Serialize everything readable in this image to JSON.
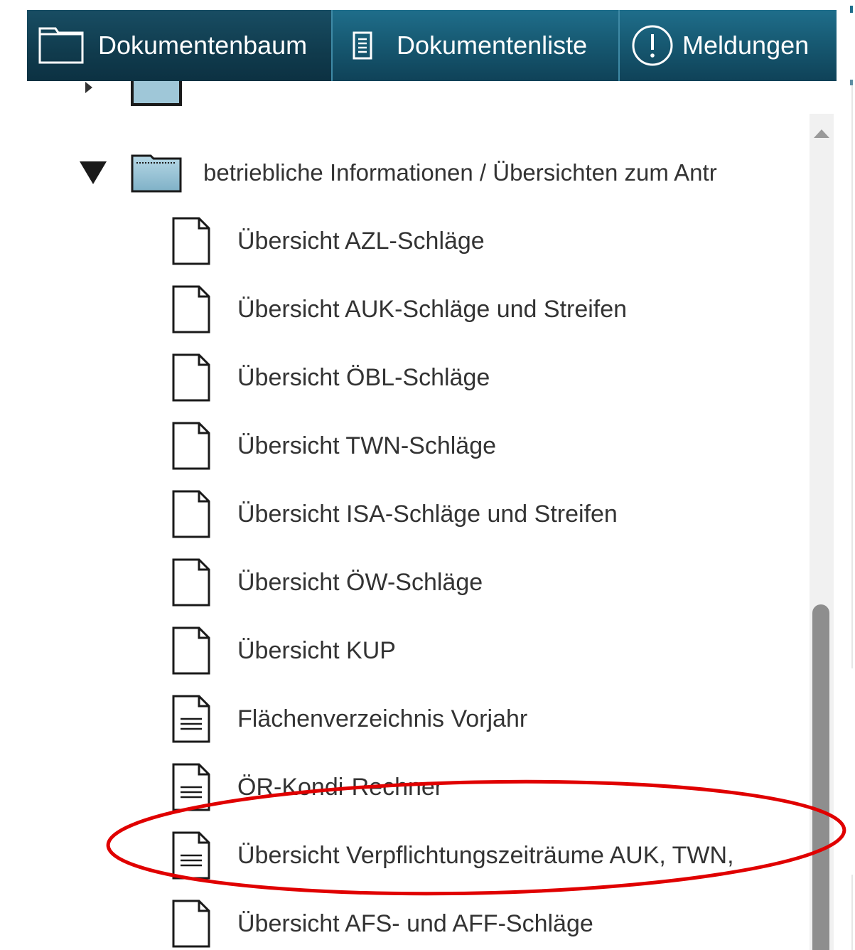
{
  "tabs": [
    {
      "label": "Dokumentenbaum",
      "icon": "folder-icon",
      "active": true
    },
    {
      "label": "Dokumentenliste",
      "icon": "document-list-icon",
      "active": false
    },
    {
      "label": "Meldungen",
      "icon": "exclamation-circle-icon",
      "active": false
    }
  ],
  "tree": {
    "folder": {
      "label": "betriebliche Informationen / Übersichten zum Antr",
      "expanded": true
    },
    "items": [
      {
        "label": "Übersicht AZL-Schläge",
        "icon": "blank-document-icon"
      },
      {
        "label": "Übersicht AUK-Schläge und Streifen",
        "icon": "blank-document-icon"
      },
      {
        "label": "Übersicht ÖBL-Schläge",
        "icon": "blank-document-icon"
      },
      {
        "label": "Übersicht TWN-Schläge",
        "icon": "blank-document-icon"
      },
      {
        "label": "Übersicht ISA-Schläge und Streifen",
        "icon": "blank-document-icon"
      },
      {
        "label": "Übersicht ÖW-Schläge",
        "icon": "blank-document-icon"
      },
      {
        "label": "Übersicht KUP",
        "icon": "blank-document-icon"
      },
      {
        "label": "Flächenverzeichnis Vorjahr",
        "icon": "text-document-icon"
      },
      {
        "label": "ÖR-Kondi-Rechner",
        "icon": "text-document-icon"
      },
      {
        "label": "Übersicht Verpflichtungszeiträume AUK, TWN,",
        "icon": "text-document-icon",
        "highlighted": true
      },
      {
        "label": "Übersicht AFS- und AFF-Schläge",
        "icon": "blank-document-icon"
      }
    ]
  },
  "colors": {
    "toolbar": "#175a73",
    "toolbar_active": "#103b4d",
    "folder_fill": "#9fc7d8",
    "highlight_ring": "#e00000",
    "text": "#333333"
  }
}
